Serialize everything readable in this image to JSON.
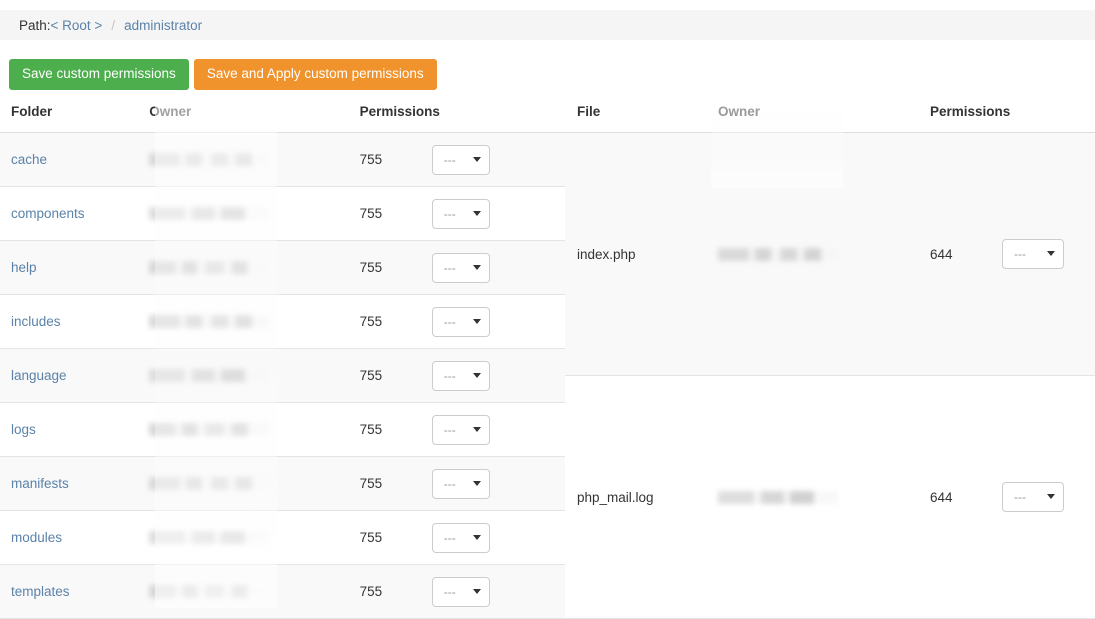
{
  "breadcrumb": {
    "label": "Path:",
    "root_link": "< Root >",
    "separator": "/",
    "current": "administrator"
  },
  "actions": {
    "save_label": "Save custom permissions",
    "save_apply_label": "Save and Apply custom permissions",
    "save_color": "#4cae4c",
    "save_apply_color": "#f0932c"
  },
  "folders_table": {
    "headers": [
      "Folder",
      "Owner",
      "Permissions",
      ""
    ],
    "rows": [
      {
        "name": "cache",
        "owner": "",
        "permissions": "755",
        "select_value": "---"
      },
      {
        "name": "components",
        "owner": "",
        "permissions": "755",
        "select_value": "---"
      },
      {
        "name": "help",
        "owner": "",
        "permissions": "755",
        "select_value": "---"
      },
      {
        "name": "includes",
        "owner": "",
        "permissions": "755",
        "select_value": "---"
      },
      {
        "name": "language",
        "owner": "",
        "permissions": "755",
        "select_value": "---"
      },
      {
        "name": "logs",
        "owner": "",
        "permissions": "755",
        "select_value": "---"
      },
      {
        "name": "manifests",
        "owner": "",
        "permissions": "755",
        "select_value": "---"
      },
      {
        "name": "modules",
        "owner": "",
        "permissions": "755",
        "select_value": "---"
      },
      {
        "name": "templates",
        "owner": "",
        "permissions": "755",
        "select_value": "---"
      }
    ]
  },
  "files_table": {
    "headers": [
      "File",
      "Owner",
      "Permissions",
      ""
    ],
    "rows": [
      {
        "name": "index.php",
        "owner": "",
        "permissions": "644",
        "select_value": "---"
      },
      {
        "name": "php_mail.log",
        "owner": "",
        "permissions": "644",
        "select_value": "---"
      }
    ]
  },
  "select_options": [
    "---"
  ],
  "colors": {
    "link": "#5b82a8",
    "row_stripe": "#f9f9f9",
    "bar_background": "#f5f5f5",
    "border": "#dddddd"
  }
}
